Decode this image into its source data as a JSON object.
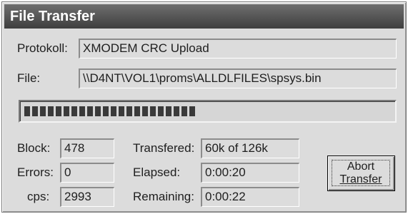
{
  "window": {
    "title": "File Transfer"
  },
  "protocol": {
    "label": "Protokoll:",
    "value": "XMODEM CRC Upload"
  },
  "file": {
    "label": "File:",
    "value": "\\\\D4NT\\VOL1\\proms\\ALLDLFILES\\spsys.bin"
  },
  "progress": {
    "fraction": 0.48
  },
  "stats": {
    "block": {
      "label": "Block:",
      "value": "478"
    },
    "errors": {
      "label": "Errors:",
      "value": "0"
    },
    "cps": {
      "label": "cps:",
      "value": "2993"
    },
    "transfered": {
      "label": "Transfered:",
      "value": "60k of 126k"
    },
    "elapsed": {
      "label": "Elapsed:",
      "value": "0:00:20"
    },
    "remaining": {
      "label": "Remaining:",
      "value": "0:00:22"
    }
  },
  "abort_button": {
    "line1": "Abort",
    "line2": "Transfer"
  }
}
